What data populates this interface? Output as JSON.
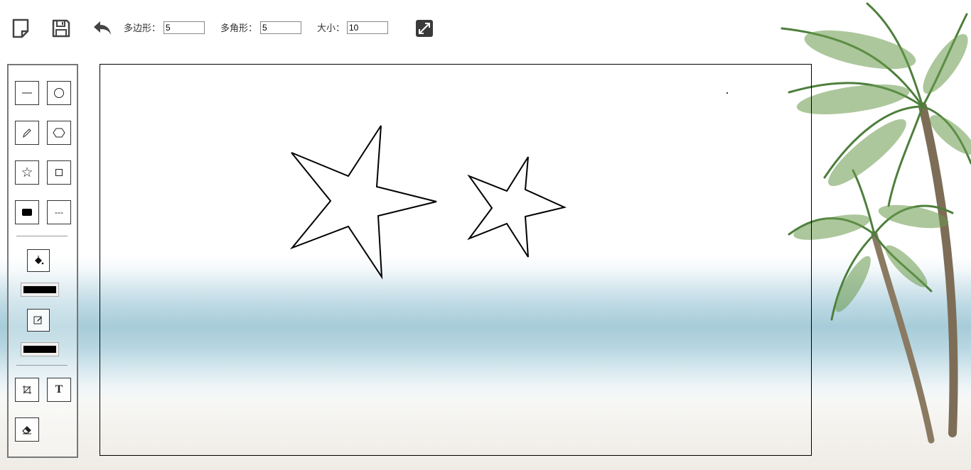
{
  "toolbar": {
    "new_icon": "new-file-icon",
    "save_icon": "save-icon",
    "undo_icon": "undo-icon",
    "polygon_label": "多边形：",
    "polygon_value": "5",
    "star_label": "多角形：",
    "star_value": "5",
    "size_label": "大小：",
    "size_value": "10",
    "fullscreen_icon": "fullscreen-icon"
  },
  "tools": [
    {
      "name": "line",
      "icon": "line-icon"
    },
    {
      "name": "circle",
      "icon": "circle-icon"
    },
    {
      "name": "pencil",
      "icon": "pencil-icon"
    },
    {
      "name": "polygon",
      "icon": "hexagon-icon"
    },
    {
      "name": "star",
      "icon": "star-icon",
      "glyph": "☆"
    },
    {
      "name": "rectangle",
      "icon": "square-icon"
    },
    {
      "name": "filled-shape",
      "icon": "filled-rect-icon"
    },
    {
      "name": "dashed-line",
      "icon": "dashed-line-icon",
      "glyph": "---"
    },
    {
      "name": "crop",
      "icon": "crop-icon"
    },
    {
      "name": "text",
      "icon": "text-icon",
      "glyph": "T"
    },
    {
      "name": "eraser",
      "icon": "eraser-icon"
    }
  ],
  "fill": {
    "icon": "paint-bucket-icon",
    "color": "#000000"
  },
  "stroke": {
    "icon": "edit-icon",
    "color": "#000000"
  },
  "canvas": {
    "stroke_color": "#000000",
    "shapes": [
      "star",
      "star",
      "dot"
    ]
  }
}
